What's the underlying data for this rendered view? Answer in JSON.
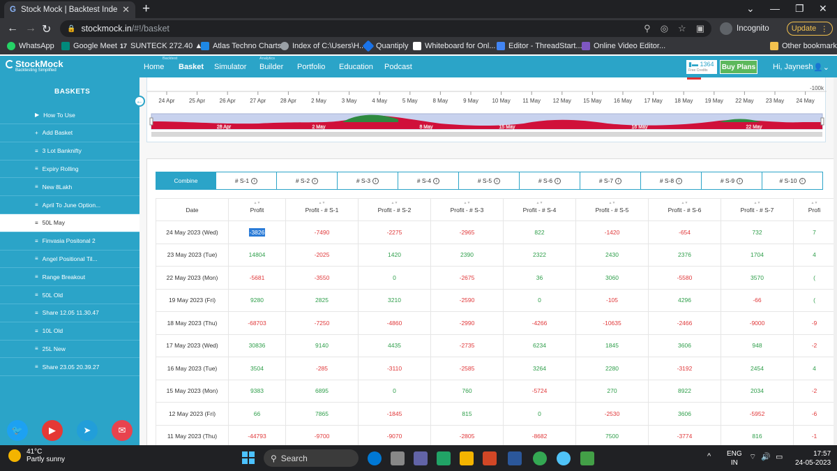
{
  "browser": {
    "tab_title": "Stock Mock | Backtest Index Strat",
    "url_host": "stockmock.in",
    "url_path": "/#!/basket",
    "profile": "Incognito",
    "update_label": "Update"
  },
  "bookmarks": [
    {
      "label": "WhatsApp",
      "color": "#25d366"
    },
    {
      "label": "Google Meet",
      "color": "#00897b"
    },
    {
      "label": "SUNTECK 272.40 ▲...",
      "color": "#ffffff"
    },
    {
      "label": "Atlas Techno Charts",
      "color": "#1e88e5"
    },
    {
      "label": "Index of C:\\Users\\H...",
      "color": "#9aa0a6"
    },
    {
      "label": "Quantiply",
      "color": "#1a73e8"
    },
    {
      "label": "Whiteboard for Onl...",
      "color": "#ffffff"
    },
    {
      "label": "Editor - ThreadStart...",
      "color": "#4285f4"
    },
    {
      "label": "Online Video Editor...",
      "color": "#7e57c2"
    }
  ],
  "other_bookmarks": "Other bookmarks",
  "app": {
    "logo": "StockMock",
    "logo_tagline": "Backtesting Simplified",
    "nav": [
      {
        "label": "Home",
        "sup": ""
      },
      {
        "label": "Basket",
        "sup": "Backtest",
        "active": true
      },
      {
        "label": "Simulator",
        "sup": ""
      },
      {
        "label": "Builder",
        "sup": "Analytics"
      },
      {
        "label": "Portfolio",
        "sup": ""
      },
      {
        "label": "Education",
        "sup": ""
      },
      {
        "label": "Podcast",
        "sup": ""
      }
    ],
    "credits_value": "1364",
    "credits_label": "Free Credits",
    "buy_plans": "Buy Plans",
    "greeting": "Hi, Jaynesh"
  },
  "sidebar": {
    "title": "BASKETS",
    "items": [
      {
        "icon": "▶",
        "label": "How To Use"
      },
      {
        "icon": "+",
        "label": "Add Basket"
      },
      {
        "icon": "≡",
        "label": "3 Lot Banknifty"
      },
      {
        "icon": "≡",
        "label": "Expiry Rolling"
      },
      {
        "icon": "≡",
        "label": "New 8Lakh"
      },
      {
        "icon": "≡",
        "label": "April To June Option..."
      },
      {
        "icon": "≡",
        "label": "50L May",
        "selected": true
      },
      {
        "icon": "≡",
        "label": "Finvasia Positonal 2"
      },
      {
        "icon": "≡",
        "label": "Angel Positional Til..."
      },
      {
        "icon": "≡",
        "label": "Range Breakout"
      },
      {
        "icon": "≡",
        "label": "50L Old"
      },
      {
        "icon": "≡",
        "label": "Share 12.05 11.30.47"
      },
      {
        "icon": "≡",
        "label": "10L Old"
      },
      {
        "icon": "≡",
        "label": "25L New"
      },
      {
        "icon": "≡",
        "label": "Share 23.05 20.39.27"
      }
    ],
    "social": [
      {
        "name": "twitter-icon",
        "color": "#1da1f2"
      },
      {
        "name": "youtube-icon",
        "color": "#e53935"
      },
      {
        "name": "telegram-icon",
        "color": "#229ed9"
      },
      {
        "name": "mail-icon",
        "color": "#e8434e"
      }
    ]
  },
  "chart": {
    "y_label": "-100k",
    "x_dates": [
      "24 Apr",
      "25 Apr",
      "26 Apr",
      "27 Apr",
      "28 Apr",
      "2 May",
      "3 May",
      "4 May",
      "5 May",
      "8 May",
      "9 May",
      "10 May",
      "11 May",
      "12 May",
      "15 May",
      "16 May",
      "17 May",
      "18 May",
      "19 May",
      "22 May",
      "23 May",
      "24 May"
    ],
    "navigator_labels": [
      "28 Apr",
      "2 May",
      "8 May",
      "15 May",
      "16 May",
      "22 May"
    ]
  },
  "table": {
    "tabs": [
      {
        "label": "Combine",
        "active": true,
        "info": false
      },
      {
        "label": "# S-1",
        "info": true
      },
      {
        "label": "# S-2",
        "info": true
      },
      {
        "label": "# S-3",
        "info": true
      },
      {
        "label": "# S-4",
        "info": true
      },
      {
        "label": "# S-5",
        "info": true
      },
      {
        "label": "# S-6",
        "info": true
      },
      {
        "label": "# S-7",
        "info": true
      },
      {
        "label": "# S-8",
        "info": true
      },
      {
        "label": "# S-9",
        "info": true
      },
      {
        "label": "# S-10",
        "info": true
      }
    ],
    "headers": [
      "Date",
      "Profit",
      "Profit - # S-1",
      "Profit - # S-2",
      "Profit - # S-3",
      "Profit - # S-4",
      "Profit - # S-5",
      "Profit - # S-6",
      "Profit - # S-7",
      "Profi"
    ],
    "rows": [
      [
        "24 May 2023 (Wed)",
        "-3826",
        "-7490",
        "-2275",
        "-2965",
        "822",
        "-1420",
        "-654",
        "732",
        "7"
      ],
      [
        "23 May 2023 (Tue)",
        "14804",
        "-2025",
        "1420",
        "2390",
        "2322",
        "2430",
        "2376",
        "1704",
        "4"
      ],
      [
        "22 May 2023 (Mon)",
        "-5681",
        "-3550",
        "0",
        "-2675",
        "36",
        "3060",
        "-5580",
        "3570",
        "("
      ],
      [
        "19 May 2023 (Fri)",
        "9280",
        "2825",
        "3210",
        "-2590",
        "0",
        "-105",
        "4296",
        "-66",
        "("
      ],
      [
        "18 May 2023 (Thu)",
        "-68703",
        "-7250",
        "-4860",
        "-2990",
        "-4266",
        "-10635",
        "-2466",
        "-9000",
        "-9"
      ],
      [
        "17 May 2023 (Wed)",
        "30836",
        "9140",
        "4435",
        "-2735",
        "6234",
        "1845",
        "3606",
        "948",
        "-2"
      ],
      [
        "16 May 2023 (Tue)",
        "3504",
        "-285",
        "-3110",
        "-2585",
        "3264",
        "2280",
        "-3192",
        "2454",
        "4"
      ],
      [
        "15 May 2023 (Mon)",
        "9383",
        "6895",
        "0",
        "760",
        "-5724",
        "270",
        "8922",
        "2034",
        "-2"
      ],
      [
        "12 May 2023 (Fri)",
        "66",
        "7865",
        "-1845",
        "815",
        "0",
        "-2530",
        "3606",
        "-5952",
        "-6"
      ],
      [
        "11 May 2023 (Thu)",
        "-44793",
        "-9700",
        "-9070",
        "-2805",
        "-8682",
        "7500",
        "-3774",
        "816",
        "-1"
      ]
    ]
  },
  "taskbar": {
    "temp": "41°C",
    "weather": "Partly sunny",
    "search": "Search",
    "lang1": "ENG",
    "lang2": "IN",
    "time": "17:57",
    "date": "24-05-2023"
  }
}
